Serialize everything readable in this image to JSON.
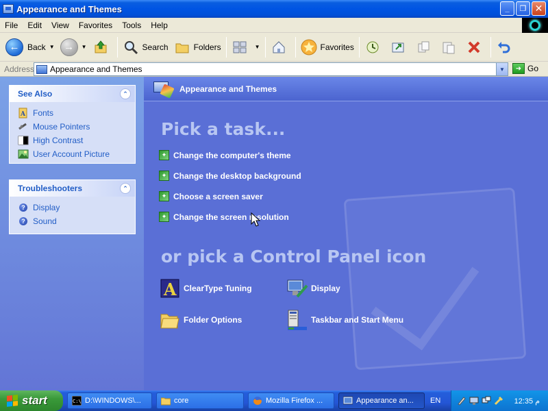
{
  "window": {
    "title": "Appearance and Themes",
    "controls": {
      "minimize": "_",
      "maximize": "❐",
      "close": "✕"
    }
  },
  "menu": [
    "File",
    "Edit",
    "View",
    "Favorites",
    "Tools",
    "Help"
  ],
  "toolbar": {
    "back": "Back",
    "search": "Search",
    "folders": "Folders",
    "favorites": "Favorites"
  },
  "address": {
    "label": "Address",
    "value": "Appearance and Themes",
    "go": "Go"
  },
  "see_also": {
    "title": "See Also",
    "items": [
      "Fonts",
      "Mouse Pointers",
      "High Contrast",
      "User Account Picture"
    ]
  },
  "troubleshooters": {
    "title": "Troubleshooters",
    "items": [
      "Display",
      "Sound"
    ]
  },
  "main": {
    "header": "Appearance and Themes",
    "pick_task": "Pick a task...",
    "tasks": [
      "Change the computer's theme",
      "Change the desktop background",
      "Choose a screen saver",
      "Change the screen resolution"
    ],
    "or_pick": "or pick a Control Panel icon",
    "icons": [
      "ClearType Tuning",
      "Display",
      "Folder Options",
      "Taskbar and Start Menu"
    ]
  },
  "taskbar": {
    "start": "start",
    "buttons": [
      "D:\\WINDOWS\\...",
      "core",
      "Mozilla Firefox ...",
      "Appearance an..."
    ],
    "language": "EN",
    "clock": "12:35 م"
  },
  "colors": {
    "titlebar": "#0054e3",
    "main_bg": "#5a6fd6",
    "link": "#215dc6",
    "start_green": "#3a9a3a"
  }
}
